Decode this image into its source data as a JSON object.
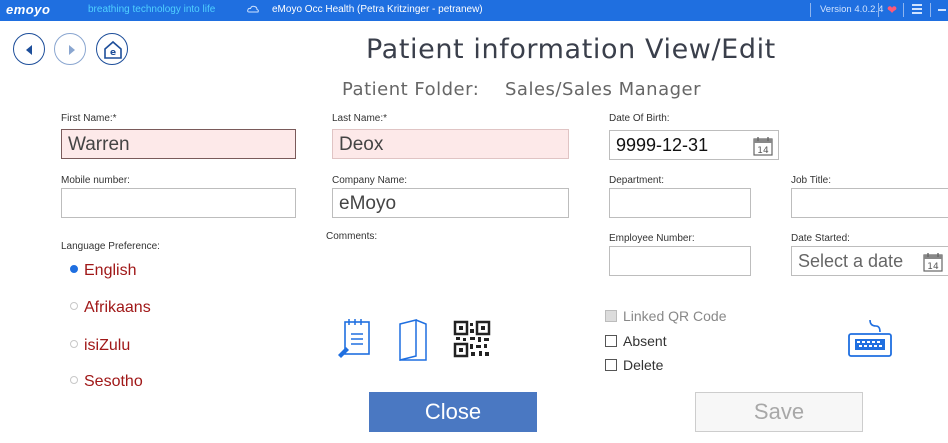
{
  "titlebar": {
    "brand": "emoyo",
    "tagline": "breathing technology into life",
    "app_title": "eMoyo Occ Health (Petra Kritzinger - petranew)",
    "version": "Version 4.0.2.4",
    "heart_icon": "heart-icon",
    "menu_icon": "hamburger-icon",
    "minimize_icon": "minimize-icon"
  },
  "nav": {
    "back_icon": "back-arrow-icon",
    "forward_icon": "forward-arrow-icon",
    "home_icon": "home-icon"
  },
  "page": {
    "title": "Patient information View/Edit",
    "folder_label": "Patient Folder:",
    "folder_value": "Sales/Sales Manager"
  },
  "fields": {
    "first_name": {
      "label": "First Name:*",
      "value": "Warren"
    },
    "last_name": {
      "label": "Last Name:*",
      "value": "Deox"
    },
    "dob": {
      "label": "Date Of Birth:",
      "value": "9999-12-31"
    },
    "mobile": {
      "label": "Mobile number:",
      "value": ""
    },
    "company": {
      "label": "Company Name:",
      "value": "eMoyo"
    },
    "department": {
      "label": "Department:",
      "value": ""
    },
    "job_title": {
      "label": "Job Title:",
      "value": ""
    },
    "comments": {
      "label": "Comments:"
    },
    "employee_number": {
      "label": "Employee Number:",
      "value": ""
    },
    "date_started": {
      "label": "Date Started:",
      "value": "Select a date"
    }
  },
  "language": {
    "label": "Language Preference:",
    "options": [
      "English",
      "Afrikaans",
      "isiZulu",
      "Sesotho"
    ],
    "selected": "English"
  },
  "actions": {
    "notes_icon": "notes-edit-icon",
    "folder_icon": "folder-icon",
    "qr_icon": "qr-code-icon",
    "keyboard_icon": "keyboard-icon"
  },
  "checkboxes": {
    "linked_qr": "Linked QR Code",
    "absent": "Absent",
    "delete": "Delete"
  },
  "buttons": {
    "close": "Close",
    "save": "Save"
  },
  "calendar_text": "14",
  "colors": {
    "titlebar": "#1f6fe0",
    "close_button": "#4a78c2",
    "required_bg": "#fde9e9",
    "radio_text": "#a01818"
  }
}
